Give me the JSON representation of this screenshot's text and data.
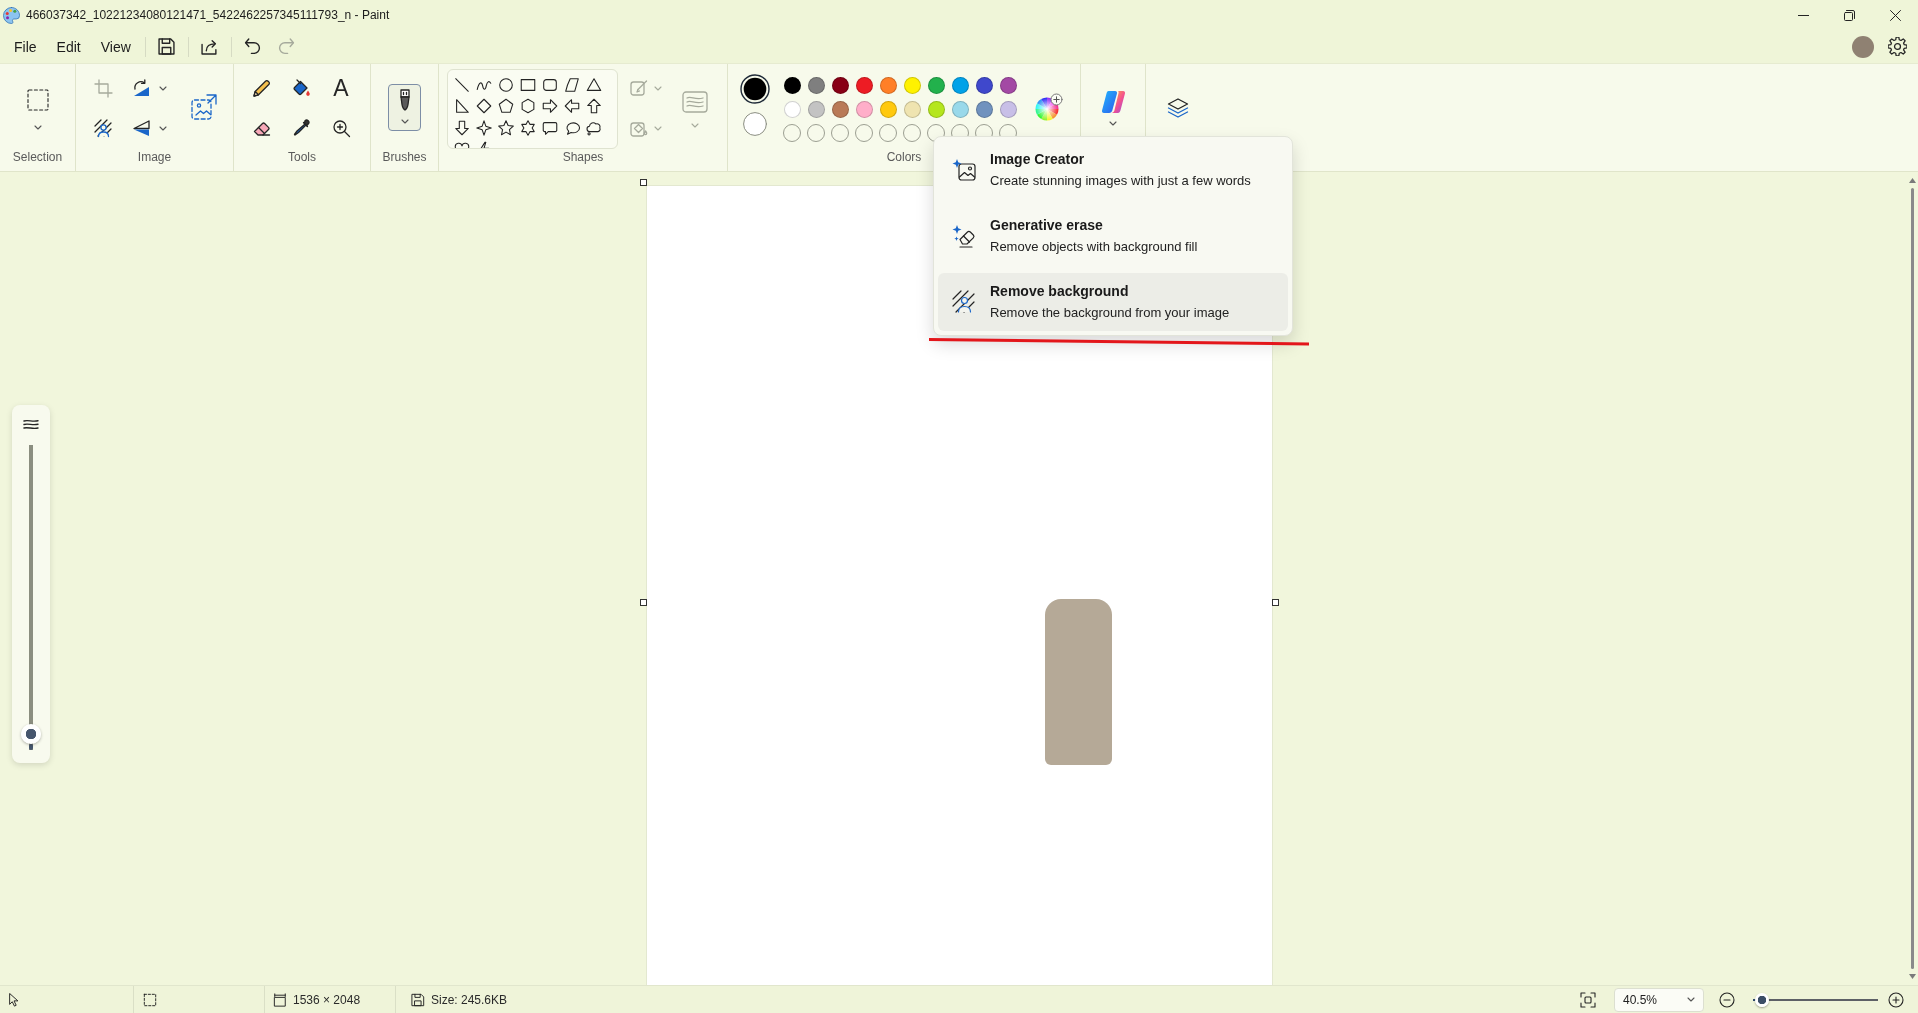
{
  "window": {
    "title": "466037342_10221234080121471_5422462257345111793_n - Paint"
  },
  "menu_bar": {
    "items": [
      {
        "label": "File"
      },
      {
        "label": "Edit"
      },
      {
        "label": "View"
      }
    ],
    "quick_access": [
      {
        "kind": "save",
        "disabled": false
      },
      {
        "kind": "share",
        "disabled": false
      },
      {
        "kind": "undo",
        "disabled": false
      },
      {
        "kind": "redo",
        "disabled": true
      }
    ]
  },
  "ribbon": {
    "groups": [
      {
        "kind": "selection",
        "label": "Selection"
      },
      {
        "kind": "image",
        "label": "Image",
        "tools": [
          {
            "kind": "crop",
            "disabled": true
          },
          {
            "kind": "rotate",
            "disabled": false
          },
          {
            "kind": "remove_background",
            "disabled": false
          },
          {
            "kind": "flip",
            "disabled": false
          },
          {
            "kind": "resize",
            "disabled": false
          }
        ]
      },
      {
        "kind": "tools",
        "label": "Tools",
        "tools": [
          {
            "kind": "pencil",
            "selected": false
          },
          {
            "kind": "fill",
            "selected": false
          },
          {
            "kind": "text",
            "glyph": "A",
            "selected": false
          },
          {
            "kind": "eraser",
            "selected": false
          },
          {
            "kind": "picker",
            "selected": false
          },
          {
            "kind": "magnifier",
            "selected": false
          }
        ]
      },
      {
        "kind": "brushes",
        "label": "Brushes",
        "selected": true
      },
      {
        "kind": "shapes",
        "label": "Shapes",
        "shape_outline": {
          "disabled": true
        },
        "shape_fill": {
          "disabled": true
        },
        "shape_style": {
          "disabled": true
        }
      },
      {
        "kind": "colors",
        "label": "Colors",
        "primary": {
          "color": "#000000"
        },
        "secondary": {
          "color": "#ffffff"
        },
        "palette": [
          {
            "kind": "swatch",
            "color": "#000000"
          },
          {
            "kind": "swatch",
            "color": "#7f7f7f"
          },
          {
            "kind": "swatch",
            "color": "#880015"
          },
          {
            "kind": "swatch",
            "color": "#ed1c24"
          },
          {
            "kind": "swatch",
            "color": "#ff7f27"
          },
          {
            "kind": "swatch",
            "color": "#fff200"
          },
          {
            "kind": "swatch",
            "color": "#22b14c"
          },
          {
            "kind": "swatch",
            "color": "#00a2e8"
          },
          {
            "kind": "swatch",
            "color": "#3f48cc"
          },
          {
            "kind": "swatch",
            "color": "#a349a4"
          },
          {
            "kind": "swatch",
            "color": "#ffffff"
          },
          {
            "kind": "swatch",
            "color": "#c3c3c3"
          },
          {
            "kind": "swatch",
            "color": "#b97a57"
          },
          {
            "kind": "swatch",
            "color": "#ffaec9"
          },
          {
            "kind": "swatch",
            "color": "#ffc90e"
          },
          {
            "kind": "swatch",
            "color": "#efe4b0"
          },
          {
            "kind": "swatch",
            "color": "#b5e61d"
          },
          {
            "kind": "swatch",
            "color": "#99d9ea"
          },
          {
            "kind": "swatch",
            "color": "#7092be"
          },
          {
            "kind": "swatch",
            "color": "#c8bfe7"
          },
          {
            "kind": "empty"
          },
          {
            "kind": "empty"
          },
          {
            "kind": "empty"
          },
          {
            "kind": "empty"
          },
          {
            "kind": "empty"
          },
          {
            "kind": "empty"
          },
          {
            "kind": "empty"
          },
          {
            "kind": "empty"
          },
          {
            "kind": "empty"
          },
          {
            "kind": "empty"
          }
        ]
      },
      {
        "kind": "copilot"
      },
      {
        "kind": "layers"
      }
    ]
  },
  "copilot_menu": {
    "items": [
      {
        "kind": "image_creator",
        "title": "Image Creator",
        "description": "Create stunning images with just a few words",
        "highlighted": false
      },
      {
        "kind": "generative_erase",
        "title": "Generative erase",
        "description": "Remove objects with background fill",
        "highlighted": false
      },
      {
        "kind": "remove_background",
        "title": "Remove background",
        "description": "Remove the background from your image",
        "highlighted": true
      }
    ]
  },
  "brush_size_slider": {
    "level": 0.02
  },
  "status_bar": {
    "canvas_size": "1536 × 2048",
    "file_size": "Size: 245.6KB",
    "zoom": "40.5%",
    "zoom_slider": {
      "level": 0.02
    }
  }
}
